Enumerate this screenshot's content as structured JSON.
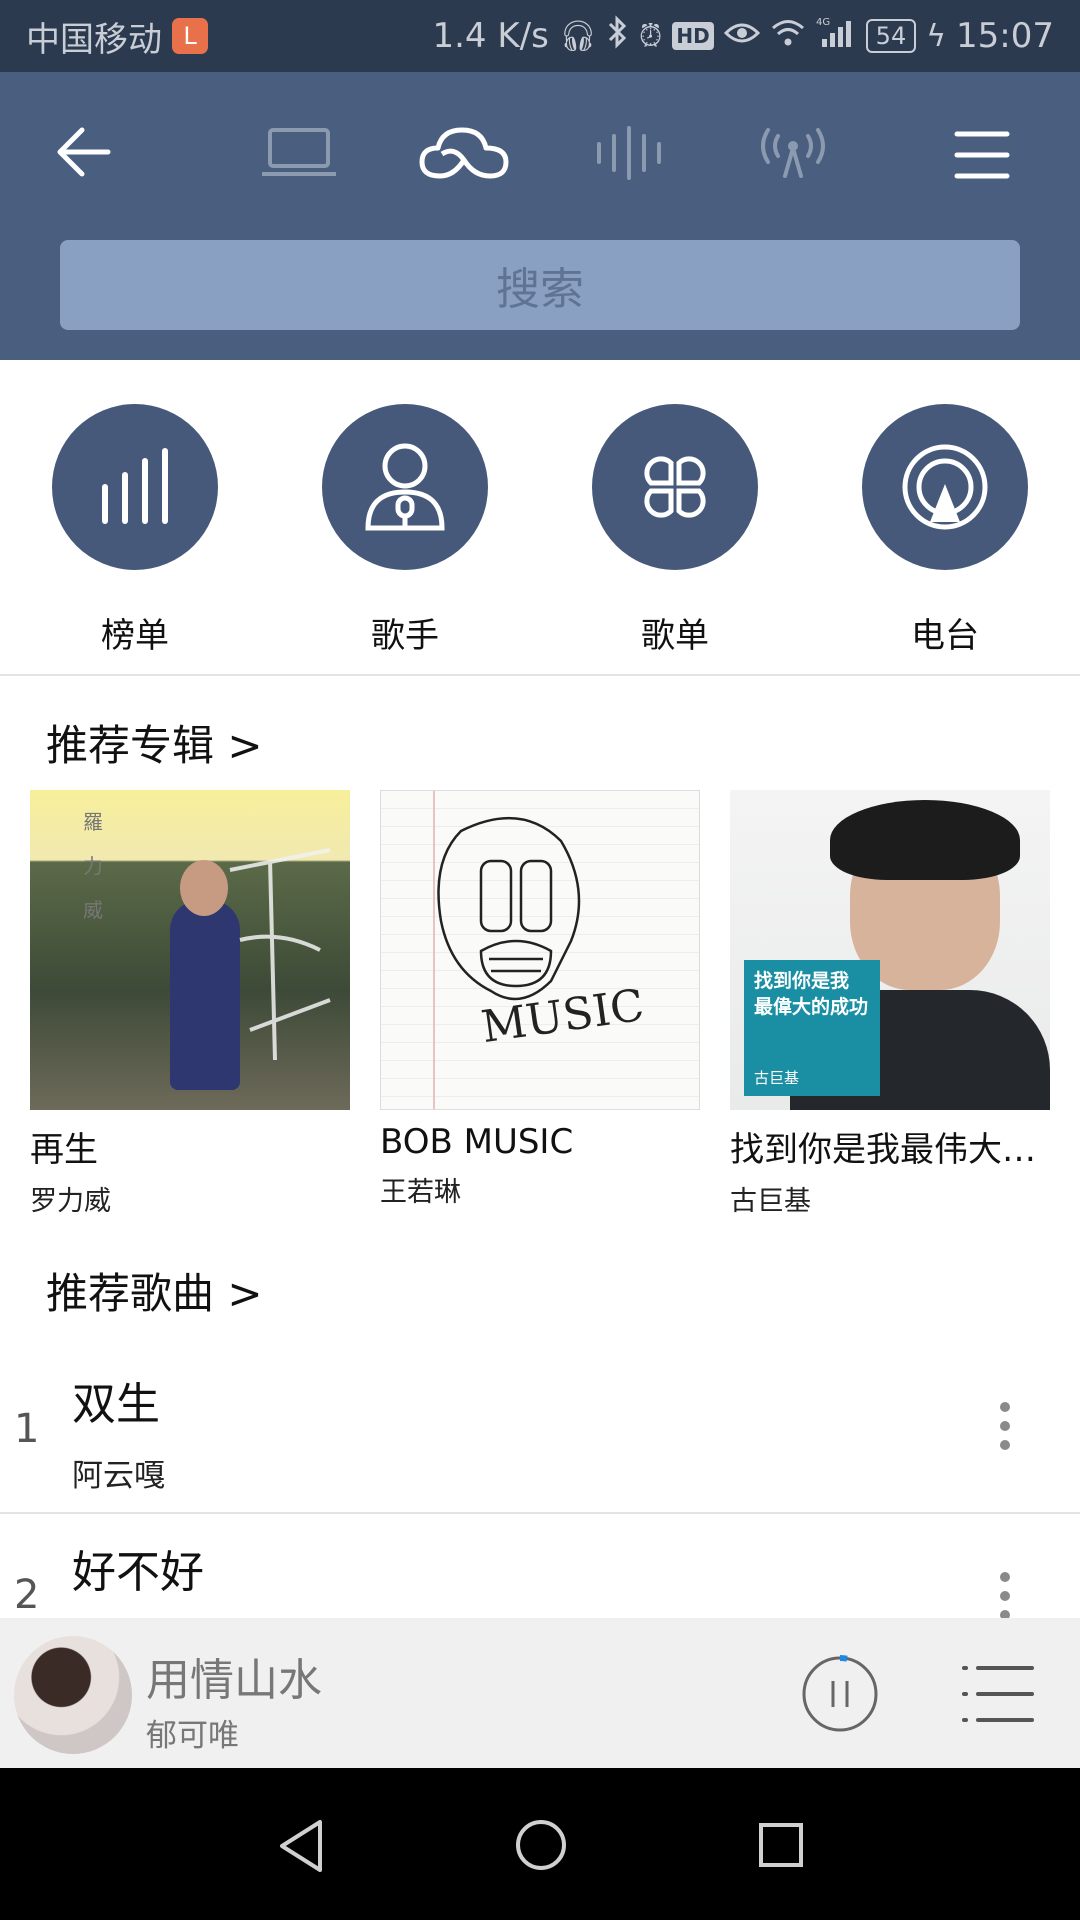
{
  "status_bar": {
    "carrier": "中国移动",
    "carrier_badge": "L",
    "net_speed": "1.4 K/s",
    "hd": "HD",
    "network": "4G",
    "battery": "54",
    "time": "15:07"
  },
  "header": {
    "tabs": [
      "laptop",
      "cloud",
      "waveform",
      "radio-antenna"
    ],
    "active_tab": "cloud",
    "search_placeholder": "搜索"
  },
  "categories": [
    {
      "label": "榜单",
      "icon": "chart-bars-icon"
    },
    {
      "label": "歌手",
      "icon": "singer-icon"
    },
    {
      "label": "歌单",
      "icon": "playlist-grid-icon"
    },
    {
      "label": "电台",
      "icon": "radio-icon"
    }
  ],
  "albums_section": {
    "title": "推荐专辑 >",
    "albums": [
      {
        "title": "再生",
        "artist": "罗力威",
        "cover_text": "羅 力 威"
      },
      {
        "title": "BOB MUSIC",
        "artist": "王若琳",
        "cover_text": "MUSIC"
      },
      {
        "title": "找到你是我最伟大…",
        "artist": "古巨基",
        "cover_text": "找到你是我 最偉大的成功",
        "cover_subtext": "古巨基"
      }
    ]
  },
  "songs_section": {
    "title": "推荐歌曲 >",
    "songs": [
      {
        "rank": "1",
        "title": "双生",
        "artist": "阿云嘎"
      },
      {
        "rank": "2",
        "title": "好不好",
        "artist": ""
      }
    ]
  },
  "now_playing": {
    "title": "用情山水",
    "artist": "郁可唯",
    "state": "playing"
  },
  "colors": {
    "status_bar": "#2c3a4f",
    "header": "#4a5f7f",
    "search_box": "#8aa0c2",
    "category_circle": "#46597a",
    "progress_accent": "#1e88e5"
  }
}
